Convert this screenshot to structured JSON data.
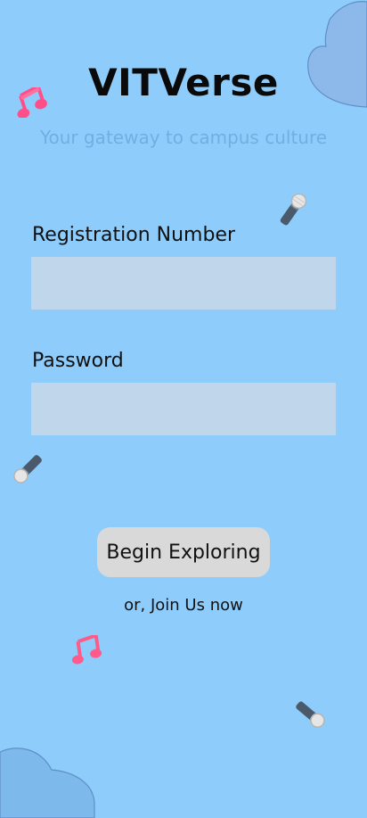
{
  "app": {
    "title": "VITVerse",
    "tagline": "Your gateway to campus culture"
  },
  "form": {
    "registration_label": "Registration Number",
    "registration_value": "",
    "password_label": "Password",
    "password_value": ""
  },
  "actions": {
    "primary_label": "Begin Exploring",
    "secondary_label": "or, Join Us now"
  },
  "decorations": {
    "icons": [
      "music-note-icon",
      "microphone-icon",
      "microphone-icon",
      "music-note-icon",
      "microphone-icon",
      "cloud-icon",
      "cloud-icon"
    ]
  },
  "colors": {
    "background": "#8ecdfb",
    "input_fill": "#c0d6ea",
    "button_fill": "#d9d9d9",
    "tagline": "#6fb0e0",
    "cloud_top": "#8db8ea",
    "cloud_bottom": "#7db9ea"
  }
}
